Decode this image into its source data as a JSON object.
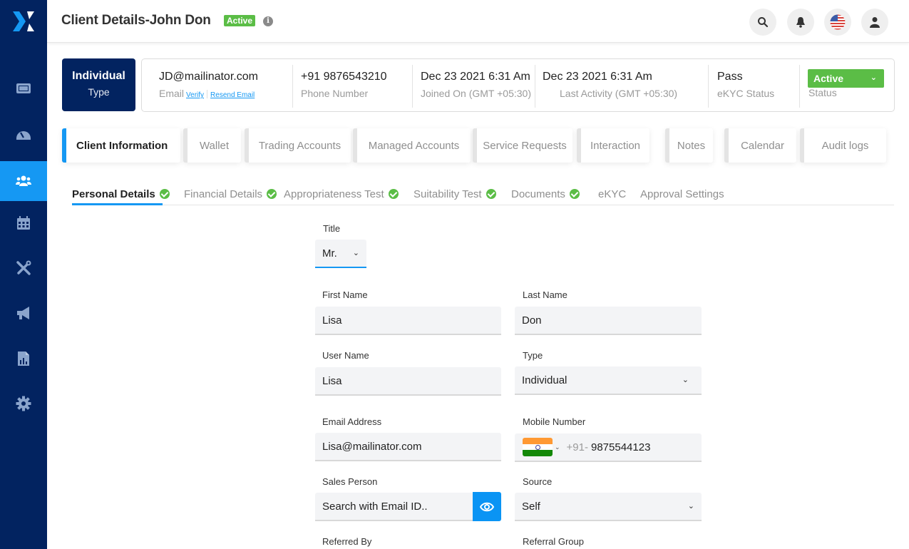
{
  "app": {
    "logo": "x-logo",
    "page_title": "Client Details-John Don",
    "title_status_badge": "Active"
  },
  "colors": {
    "sidebar_bg": "#022360",
    "accent_blue": "#1598f3",
    "active_green": "#5bbd46"
  },
  "sidebar": {
    "items": [
      {
        "icon": "ticket-icon",
        "active": false
      },
      {
        "icon": "dashboard-gauge-icon",
        "active": false
      },
      {
        "icon": "users-icon",
        "active": true
      },
      {
        "icon": "calendar-icon",
        "active": false
      },
      {
        "icon": "tools-icon",
        "active": false
      },
      {
        "icon": "megaphone-icon",
        "active": false
      },
      {
        "icon": "report-file-icon",
        "active": false
      },
      {
        "icon": "gear-icon",
        "active": false
      }
    ]
  },
  "topbar": {
    "buttons": [
      "search-icon",
      "bell-icon",
      "us-flag-icon",
      "user-icon"
    ]
  },
  "summary": {
    "type_value": "Individual",
    "type_label": "Type",
    "email_value": "JD@mailinator.com",
    "email_label": "Email",
    "verify_link": "Verify",
    "resend_link": "Resend Email",
    "phone_value": "+91 9876543210",
    "phone_label": "Phone Number",
    "joined_value": "Dec 23 2021 6:31 Am",
    "joined_label": "Joined On (GMT +05:30)",
    "last_activity_value": "Dec 23 2021 6:31 Am",
    "last_activity_label": "Last Activity (GMT +05:30)",
    "ekyc_value": "Pass",
    "ekyc_label": "eKYC Status",
    "status_value": "Active",
    "status_label": "Status"
  },
  "tabs": [
    {
      "label": "Client Information",
      "active": true
    },
    {
      "label": "Wallet"
    },
    {
      "label": "Trading Accounts"
    },
    {
      "label": "Managed Accounts"
    },
    {
      "label": "Service Requests"
    },
    {
      "label": "Interaction"
    },
    {
      "label": "Notes"
    },
    {
      "label": "Calendar"
    },
    {
      "label": "Audit logs"
    }
  ],
  "subtabs": [
    {
      "label": "Personal Details",
      "active": true,
      "completed": true
    },
    {
      "label": "Financial Details",
      "completed": true
    },
    {
      "label": "Appropriateness Test",
      "completed": true
    },
    {
      "label": "Suitability Test",
      "completed": true
    },
    {
      "label": "Documents",
      "completed": true
    },
    {
      "label": "eKYC",
      "completed": false
    },
    {
      "label": "Approval Settings",
      "completed": false
    }
  ],
  "form": {
    "title": {
      "label": "Title",
      "value": "Mr."
    },
    "first_name": {
      "label": "First Name",
      "value": "Lisa"
    },
    "last_name": {
      "label": "Last Name",
      "value": "Don"
    },
    "user_name": {
      "label": "User Name",
      "value": "Lisa"
    },
    "type": {
      "label": "Type",
      "value": "Individual"
    },
    "email": {
      "label": "Email Address",
      "value": "Lisa@mailinator.com"
    },
    "mobile": {
      "label": "Mobile Number",
      "country_flag": "india-flag-icon",
      "prefix": "+91-",
      "value": "9875544123"
    },
    "sales_person": {
      "label": "Sales Person",
      "placeholder": "Search with Email ID.."
    },
    "source": {
      "label": "Source",
      "value": "Self"
    },
    "referred_by": {
      "label": "Referred By"
    },
    "referral_group": {
      "label": "Referral Group"
    }
  }
}
